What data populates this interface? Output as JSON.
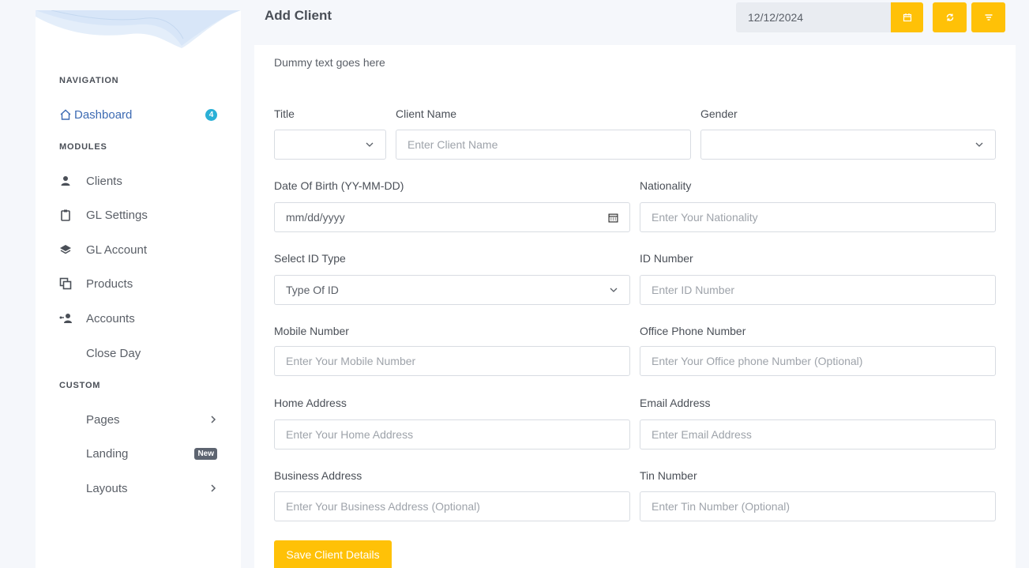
{
  "header": {
    "title": "Add Client",
    "date_value": "12/12/2024",
    "buttons": [
      {
        "icon": "calendar-icon"
      },
      {
        "icon": "refresh-icon"
      },
      {
        "icon": "filter-icon"
      }
    ]
  },
  "sidebar": {
    "sections": {
      "navigation": "NAVIGATION",
      "modules": "MODULES",
      "custom": "CUSTOM"
    },
    "dashboard": {
      "label": "Dashboard",
      "badge": "4",
      "icon": "home-icon"
    },
    "modules": [
      {
        "label": "Clients",
        "icon": "user-icon"
      },
      {
        "label": "GL Settings",
        "icon": "clipboard-icon"
      },
      {
        "label": "GL Account",
        "icon": "layers-icon"
      },
      {
        "label": "Products",
        "icon": "copy-icon"
      },
      {
        "label": "Accounts",
        "icon": "user-transfer-icon"
      },
      {
        "label": "Close Day",
        "icon": ""
      }
    ],
    "custom": [
      {
        "label": "Pages",
        "right": "chevron-right-icon"
      },
      {
        "label": "Landing",
        "badge": "New"
      },
      {
        "label": "Layouts",
        "right": "chevron-right-icon"
      }
    ]
  },
  "main": {
    "subtitle": "Dummy text goes here",
    "form": {
      "title": {
        "label": "Title",
        "value": ""
      },
      "client_name": {
        "label": "Client Name",
        "placeholder": "Enter Client Name"
      },
      "gender": {
        "label": "Gender",
        "value": ""
      },
      "dob": {
        "label": "Date Of Birth (YY-MM-DD)",
        "placeholder": "mm/dd/yyyy"
      },
      "nationality": {
        "label": "Nationality",
        "placeholder": "Enter Your Nationality"
      },
      "id_type": {
        "label": "Select ID Type",
        "value": "Type Of ID"
      },
      "id_number": {
        "label": "ID Number",
        "placeholder": "Enter ID Number"
      },
      "mobile": {
        "label": "Mobile Number",
        "placeholder": "Enter Your Mobile Number"
      },
      "office_phone": {
        "label": "Office Phone Number",
        "placeholder": "Enter Your Office phone Number (Optional)"
      },
      "home_address": {
        "label": "Home Address",
        "placeholder": "Enter Your Home Address"
      },
      "email": {
        "label": "Email Address",
        "placeholder": "Enter Email Address"
      },
      "business_address": {
        "label": "Business Address",
        "placeholder": "Enter Your Business Address (Optional)"
      },
      "tin": {
        "label": "Tin Number",
        "placeholder": "Enter Tin Number (Optional)"
      },
      "save_label": "Save Client Details"
    }
  },
  "colors": {
    "accent": "#ffc107",
    "link": "#3d6bb3",
    "badge": "#2ab0d6"
  }
}
